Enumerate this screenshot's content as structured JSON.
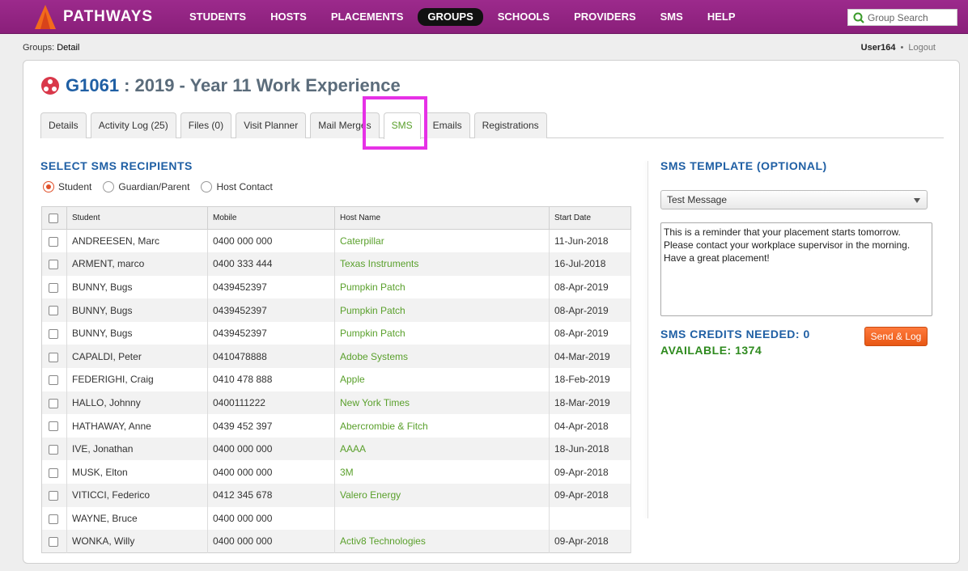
{
  "app": {
    "brand": "PATHWAYS"
  },
  "nav": {
    "items": [
      {
        "label": "STUDENTS",
        "active": false
      },
      {
        "label": "HOSTS",
        "active": false
      },
      {
        "label": "PLACEMENTS",
        "active": false
      },
      {
        "label": "GROUPS",
        "active": true
      },
      {
        "label": "SCHOOLS",
        "active": false
      },
      {
        "label": "PROVIDERS",
        "active": false
      },
      {
        "label": "SMS",
        "active": false
      },
      {
        "label": "HELP",
        "active": false
      }
    ],
    "search_placeholder": "Group Search"
  },
  "breadcrumb": {
    "section": "Groups",
    "page": "Detail"
  },
  "user": {
    "name": "User164",
    "separator": "•",
    "logout": "Logout"
  },
  "group": {
    "code": "G1061",
    "title": ": 2019 - Year 11 Work Experience"
  },
  "tabs": [
    {
      "label": "Details",
      "active": false
    },
    {
      "label": "Activity Log (25)",
      "active": false
    },
    {
      "label": "Files (0)",
      "active": false
    },
    {
      "label": "Visit Planner",
      "active": false
    },
    {
      "label": "Mail Merges",
      "active": false
    },
    {
      "label": "SMS",
      "active": true
    },
    {
      "label": "Emails",
      "active": false
    },
    {
      "label": "Registrations",
      "active": false
    }
  ],
  "recipients": {
    "title": "SELECT SMS RECIPIENTS",
    "options": [
      {
        "label": "Student",
        "selected": true
      },
      {
        "label": "Guardian/Parent",
        "selected": false
      },
      {
        "label": "Host Contact",
        "selected": false
      }
    ],
    "columns": [
      "Student",
      "Mobile",
      "Host Name",
      "Start Date"
    ],
    "rows": [
      [
        "ANDREESEN, Marc",
        "0400 000 000",
        "Caterpillar",
        "11-Jun-2018"
      ],
      [
        "ARMENT, marco",
        "0400 333 444",
        "Texas Instruments",
        "16-Jul-2018"
      ],
      [
        "BUNNY, Bugs",
        "0439452397",
        "Pumpkin Patch",
        "08-Apr-2019"
      ],
      [
        "BUNNY, Bugs",
        "0439452397",
        "Pumpkin Patch",
        "08-Apr-2019"
      ],
      [
        "BUNNY, Bugs",
        "0439452397",
        "Pumpkin Patch",
        "08-Apr-2019"
      ],
      [
        "CAPALDI, Peter",
        "0410478888",
        "Adobe Systems",
        "04-Mar-2019"
      ],
      [
        "FEDERIGHI, Craig",
        "0410 478 888",
        "Apple",
        "18-Feb-2019"
      ],
      [
        "HALLO, Johnny",
        "0400111222",
        "New York Times",
        "18-Mar-2019"
      ],
      [
        "HATHAWAY, Anne",
        "0439 452 397",
        "Abercrombie & Fitch",
        "04-Apr-2018"
      ],
      [
        "IVE, Jonathan",
        "0400 000 000",
        "AAAA",
        "18-Jun-2018"
      ],
      [
        "MUSK, Elton",
        "0400 000 000",
        "3M",
        "09-Apr-2018"
      ],
      [
        "VITICCI, Federico",
        "0412 345 678",
        "Valero Energy",
        "09-Apr-2018"
      ],
      [
        "WAYNE, Bruce",
        "0400 000 000",
        "",
        ""
      ],
      [
        "WONKA, Willy",
        "0400 000 000",
        "Activ8 Technologies",
        "09-Apr-2018"
      ]
    ]
  },
  "template": {
    "title": "SMS TEMPLATE (OPTIONAL)",
    "selected": "Test Message",
    "message": "This is a reminder that your placement starts tomorrow.\nPlease contact your workplace supervisor in the morning.\nHave a great placement!",
    "credits_needed": "SMS CREDITS NEEDED: 0",
    "available": "AVAILABLE: 1374",
    "send_label": "Send & Log"
  },
  "colors": {
    "nav_bg": "#8a1f7a",
    "accent_blue": "#1f5fa4",
    "link_green": "#5aa02c",
    "send_orange": "#e85714",
    "highlight": "#e631e6"
  }
}
